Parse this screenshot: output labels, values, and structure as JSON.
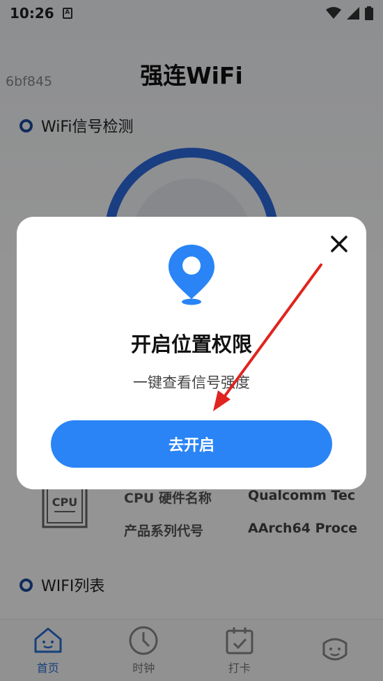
{
  "status_bar": {
    "time": "10:26",
    "notification_glyph": "A"
  },
  "app": {
    "title": "强连WiFi",
    "ssid": "6bf845"
  },
  "sections": {
    "signal_detection": "WiFi信号检测",
    "wifi_list": "WIFI列表"
  },
  "cpu_info": {
    "icon_label": "CPU",
    "rows": [
      {
        "key": "CPU 硬件名称",
        "value": "Qualcomm Tec"
      },
      {
        "key": "产品系列代号",
        "value": "AArch64 Proce"
      }
    ]
  },
  "tabs": [
    {
      "label": "首页",
      "icon": "home-icon",
      "active": true
    },
    {
      "label": "时钟",
      "icon": "clock-icon"
    },
    {
      "label": "打卡",
      "icon": "calendar-check-icon"
    },
    {
      "label": "",
      "icon": "face-icon"
    }
  ],
  "dialog": {
    "title": "开启位置权限",
    "subtitle": "一键查看信号强度",
    "button_label": "去开启"
  },
  "colors": {
    "accent": "#2a84f6",
    "section_dot": "#1a4c9e",
    "arrow": "#e0241f"
  }
}
